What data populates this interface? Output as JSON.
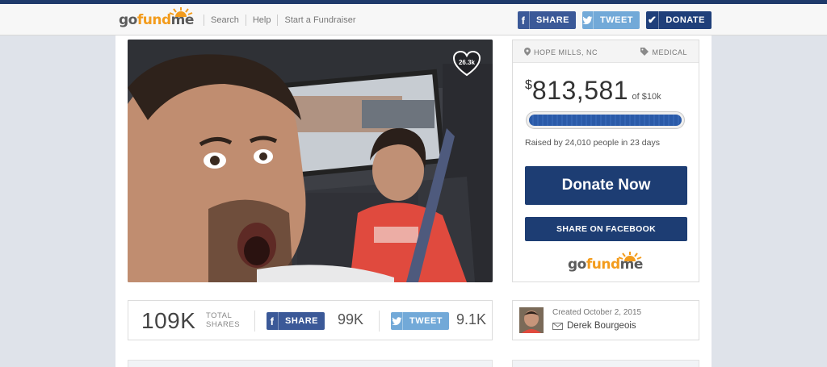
{
  "header": {
    "logo": {
      "go": "go",
      "fund": "fund",
      "me": "me"
    },
    "nav": [
      "Search",
      "Help",
      "Start a Fundraiser"
    ],
    "share_label": "SHARE",
    "tweet_label": "TWEET",
    "donate_label": "DONATE"
  },
  "campaign": {
    "hearts": "26.3k",
    "location": "HOPE MILLS, NC",
    "category": "MEDICAL",
    "currency": "$",
    "raised": "813,581",
    "goal_text": "of $10k",
    "progress": 1.0,
    "raised_by": "Raised by 24,010 people in 23 days",
    "donate_now": "Donate Now",
    "share_facebook": "SHARE ON FACEBOOK"
  },
  "shares": {
    "total": "109K",
    "total_label_1": "TOTAL",
    "total_label_2": "SHARES",
    "fb_label": "SHARE",
    "fb_count": "99K",
    "tw_label": "TWEET",
    "tw_count": "9.1K"
  },
  "creator": {
    "created": "Created October 2, 2015",
    "name": "Derek Bourgeois"
  },
  "colors": {
    "navy": "#1d3d73",
    "facebook": "#3b5998",
    "twitter": "#72a9d8",
    "brand_orange": "#f39c1d"
  }
}
